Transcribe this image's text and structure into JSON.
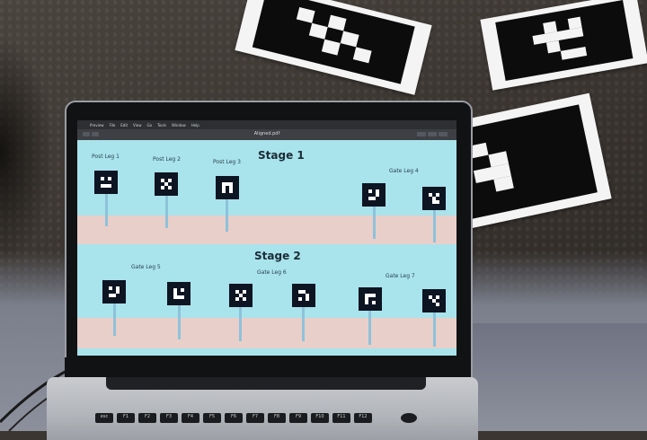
{
  "screen": {
    "menubar": [
      "Preview",
      "File",
      "Edit",
      "View",
      "Go",
      "Tools",
      "Window",
      "Help"
    ],
    "window_title": "Aligned.pdf",
    "stage1": {
      "title": "Stage 1",
      "labels": [
        "Post Leg 1",
        "Post Leg 2",
        "Post Leg 3",
        "Gate Leg 4"
      ]
    },
    "stage2": {
      "title": "Stage 2",
      "labels": [
        "Gate Leg 5",
        "Gate Leg 6",
        "Gate Leg 7"
      ]
    }
  },
  "colors": {
    "screen_bg": "#a9e3ec",
    "ground_band": "#e9cfc9",
    "marker": "#0d1422",
    "pole": "#8ec2da"
  },
  "keyboard": {
    "top_row": [
      "esc",
      "F1",
      "F2",
      "F3",
      "F4",
      "F5",
      "F6",
      "F7",
      "F8",
      "F9",
      "F10",
      "F11",
      "F12"
    ]
  }
}
